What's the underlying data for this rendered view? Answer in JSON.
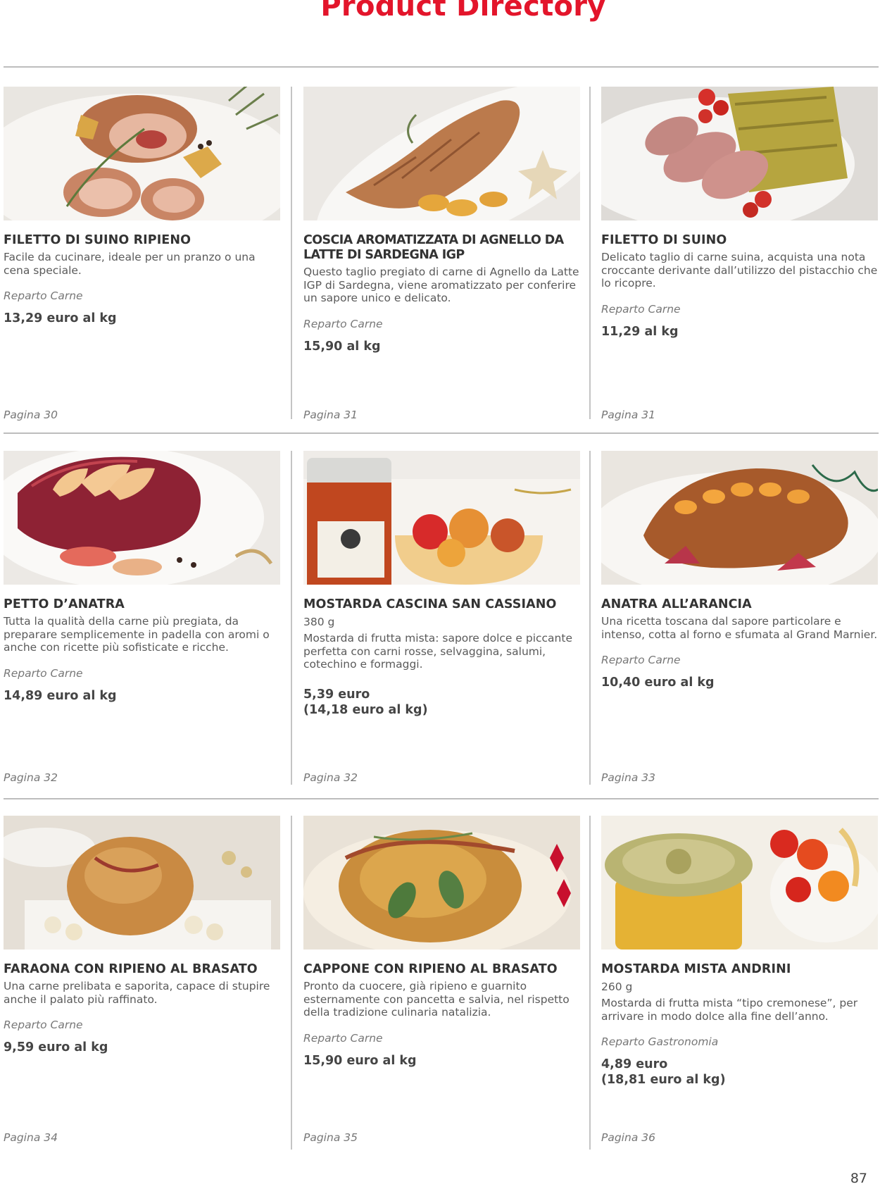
{
  "header": {
    "title": "Product Directory"
  },
  "colors": {
    "accent": "#e3152b",
    "rule": "#bdbdbd"
  },
  "rows": [
    {
      "cards": [
        {
          "image": "stuffed-pork-roll-photo",
          "title": "FILETTO DI SUINO RIPIENO",
          "weight": "",
          "description": "Facile da cucinare, ideale per un pranzo o una cena speciale.",
          "department": "Reparto Carne",
          "price": "13,29 euro al kg",
          "page_ref": "Pagina 30"
        },
        {
          "image": "lamb-leg-photo",
          "title": "COSCIA AROMATIZZATA DI AGNELLO DA LATTE DI SARDEGNA IGP",
          "weight": "",
          "description": "Questo taglio pregiato di carne di Agnello da Latte IGP di Sardegna, viene aromatizzato per conferire un sapore unico e delicato.",
          "department": "Reparto Carne",
          "price": "15,90 al kg",
          "page_ref": "Pagina 31"
        },
        {
          "image": "pistachio-pork-fillet-photo",
          "title": "FILETTO DI SUINO",
          "weight": "",
          "description": "Delicato taglio di carne suina, acquista una nota croccante derivante dall’utilizzo del pistacchio che lo ricopre.",
          "department": "Reparto Carne",
          "price": "11,29 al kg",
          "page_ref": "Pagina 31"
        }
      ]
    },
    {
      "cards": [
        {
          "image": "duck-breast-photo",
          "title": "PETTO D’ANATRA",
          "weight": "",
          "description": "Tutta la qualità della carne più pregiata, da preparare semplicemente in padella con aromi o anche con ricette più sofisticate e ricche.",
          "department": "Reparto Carne",
          "price": "14,89 euro al kg",
          "page_ref": "Pagina 32"
        },
        {
          "image": "mostarda-jar-photo",
          "title": "MOSTARDA CASCINA SAN CASSIANO",
          "weight": "380 g",
          "description": "Mostarda di frutta mista: sapore dolce e piccante perfetta con carni rosse, selvaggina, salumi, cotechino e formaggi.",
          "department": "",
          "price": "5,39 euro\n(14,18 euro al kg)",
          "page_ref": "Pagina 32"
        },
        {
          "image": "orange-duck-photo",
          "title": "ANATRA ALL’ARANCIA",
          "weight": "",
          "description": "Una ricetta toscana dal sapore particolare e intenso, cotta al forno e sfumata al Grand Marnier.",
          "department": "Reparto Carne",
          "price": "10,40 euro al kg",
          "page_ref": "Pagina 33"
        }
      ]
    },
    {
      "cards": [
        {
          "image": "guinea-fowl-photo",
          "title": "FARAONA CON RIPIENO AL BRASATO",
          "weight": "",
          "description": "Una carne prelibata e saporita, capace di stupire anche il palato più raffinato.",
          "department": "Reparto Carne",
          "price": "9,59 euro al kg",
          "page_ref": "Pagina 34"
        },
        {
          "image": "capon-photo",
          "title": "CAPPONE CON RIPIENO AL BRASATO",
          "weight": "",
          "description": "Pronto da cuocere, già ripieno e guarnito esternamente con pancetta e salvia, nel rispetto della tradizione culinaria natalizia.",
          "department": "Reparto Carne",
          "price": "15,90 euro al kg",
          "page_ref": "Pagina 35"
        },
        {
          "image": "mostarda-andrini-photo",
          "title": "MOSTARDA MISTA ANDRINI",
          "weight": "260 g",
          "description": "Mostarda di frutta mista “tipo cremonese”, per arrivare in modo dolce alla fine dell’anno.",
          "department": "Reparto Gastronomia",
          "price": "4,89 euro\n(18,81 euro al kg)",
          "page_ref": "Pagina 36"
        }
      ]
    }
  ],
  "footer": {
    "page_number": "87"
  }
}
